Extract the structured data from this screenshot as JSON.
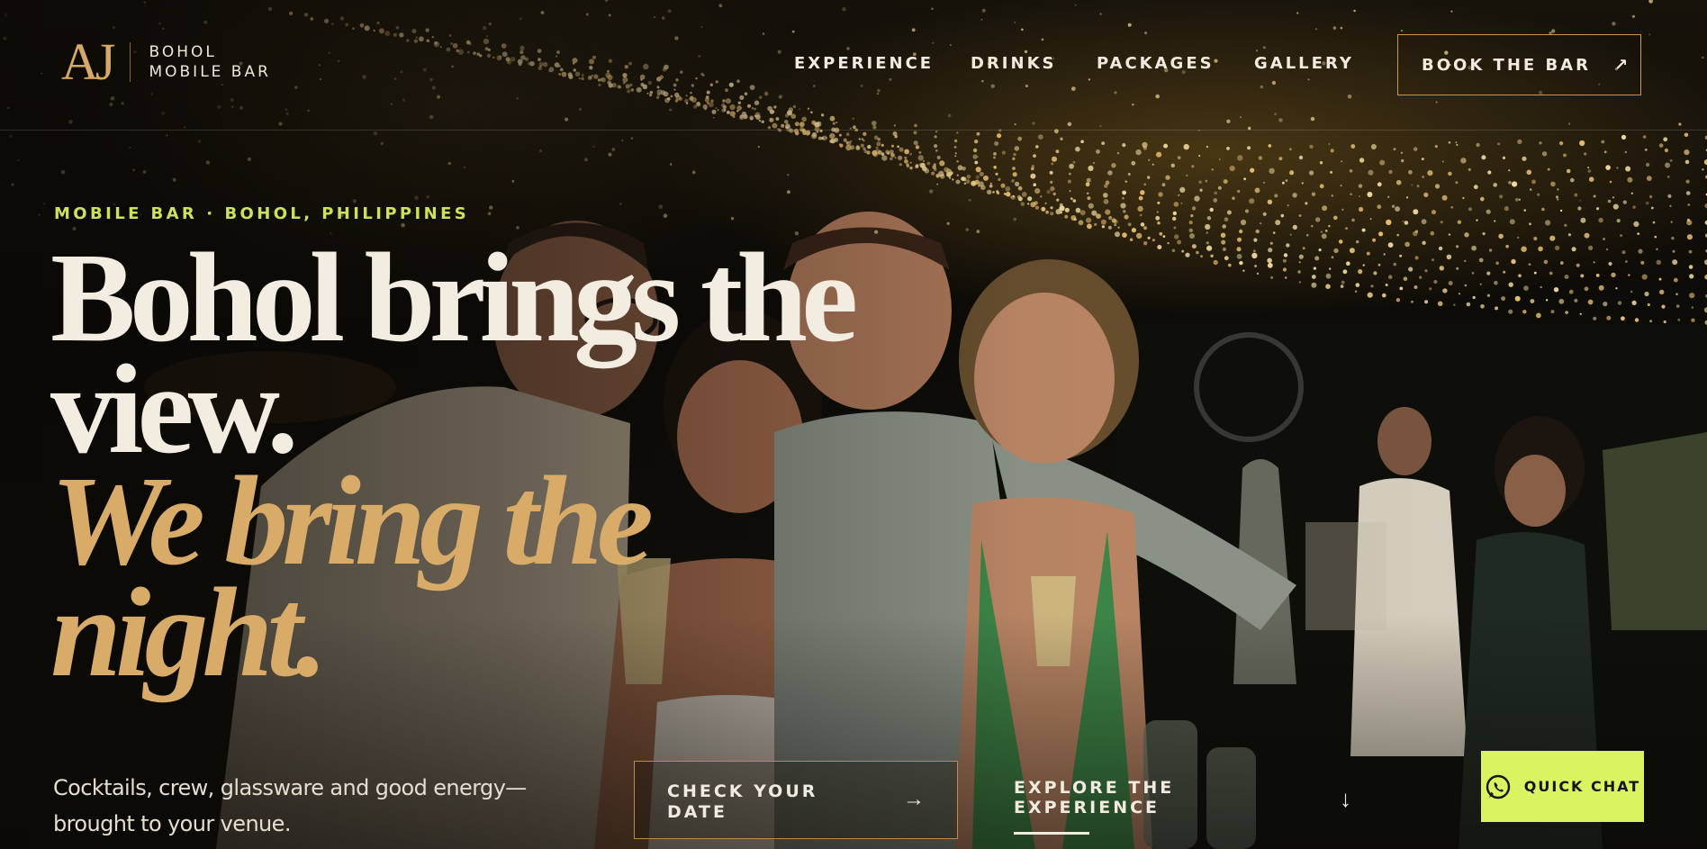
{
  "brand": {
    "monogram": "AJ",
    "name_line1": "BOHOL",
    "name_line2": "MOBILE BAR"
  },
  "nav": {
    "items": [
      "EXPERIENCE",
      "DRINKS",
      "PACKAGES",
      "GALLERY"
    ],
    "book_label": "BOOK THE BAR",
    "book_arrow": "↗"
  },
  "hero": {
    "eyebrow_left": "MOBILE BAR",
    "eyebrow_sep": "·",
    "eyebrow_right": "BOHOL, PHILIPPINES",
    "headline_line1": "Bohol brings the",
    "headline_line2": "view.",
    "headline_line3": "We bring the",
    "headline_line4": "night.",
    "subcopy": "Cocktails, crew, glassware and good energy—brought to your venue.",
    "cta_primary_line1": "CHECK YOUR",
    "cta_primary_line2": "DATE",
    "cta_primary_arrow": "→",
    "cta_secondary_line1": "EXPLORE THE",
    "cta_secondary_line2": "EXPERIENCE",
    "cta_secondary_arrow": "↓"
  },
  "chat": {
    "label": "QUICK CHAT",
    "icon": "whatsapp-icon"
  },
  "colors": {
    "accent_gold": "#d8ab68",
    "accent_lime": "#d9f460",
    "eyebrow_lime": "#cbe35a",
    "text_cream": "#f3ece1"
  }
}
